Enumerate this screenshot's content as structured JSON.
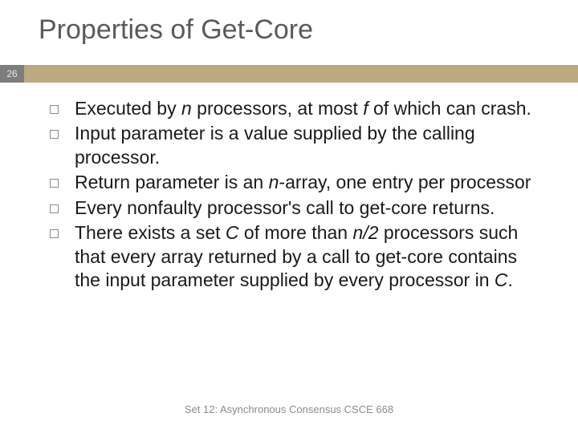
{
  "title": "Properties of Get-Core",
  "slide_number": "26",
  "bullets": {
    "b0": {
      "pre": "Executed by ",
      "i0": "n",
      "mid0": " processors, at most ",
      "i1": "f",
      "post": " of which can crash."
    },
    "b1": {
      "text": "Input parameter is a value supplied by the calling processor."
    },
    "b2": {
      "pre": "Return parameter is an ",
      "i0": "n",
      "post": "-array, one entry per processor"
    },
    "b3": {
      "text": "Every nonfaulty processor's call to get-core returns."
    },
    "b4": {
      "pre": "There exists a set ",
      "i0": "C",
      "mid0": " of more than ",
      "i1": "n/2",
      "mid1": " processors such that every array returned by a call to get-core contains the input parameter supplied by every processor in ",
      "i2": "C",
      "post": "."
    }
  },
  "footer": "Set 12: Asynchronous Consensus    CSCE 668"
}
